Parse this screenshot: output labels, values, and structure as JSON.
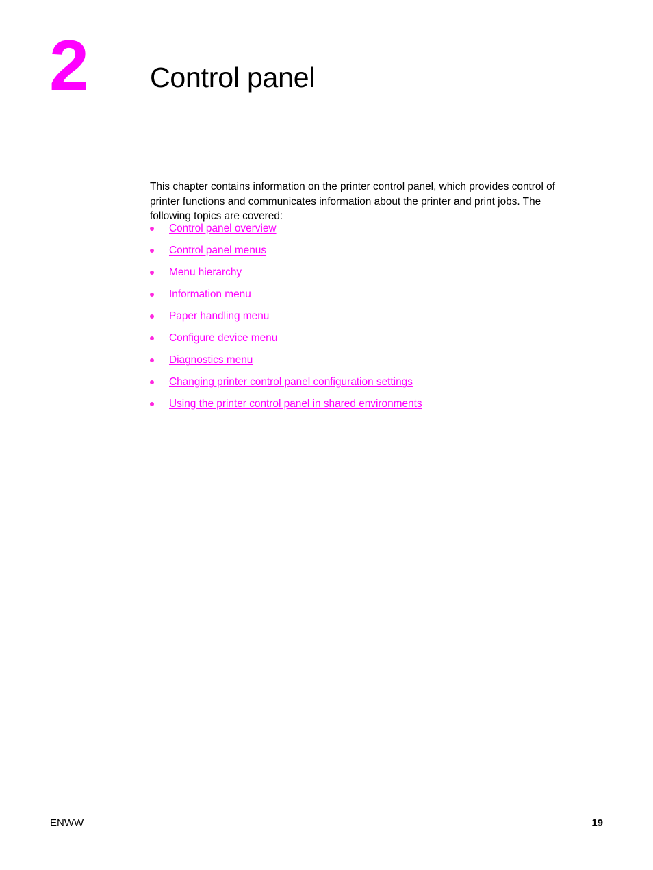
{
  "document": {
    "background_color": "#ffffff",
    "accent_color": "#ff00ff",
    "text_color": "#000000"
  },
  "chapter": {
    "number": "2",
    "title": "Control panel"
  },
  "intro": {
    "paragraph": "This chapter contains information on the printer control panel, which provides control of printer functions and communicates information about the printer and print jobs. The following topics are covered:"
  },
  "topics": [
    {
      "label": "Control panel overview"
    },
    {
      "label": "Control panel menus"
    },
    {
      "label": "Menu hierarchy"
    },
    {
      "label": "Information menu"
    },
    {
      "label": "Paper handling menu"
    },
    {
      "label": "Configure device menu"
    },
    {
      "label": "Diagnostics menu"
    },
    {
      "label": "Changing printer control panel configuration settings"
    },
    {
      "label": "Using the printer control panel in shared environments"
    }
  ],
  "footer": {
    "left_label": "ENWW",
    "page_number": "19"
  }
}
